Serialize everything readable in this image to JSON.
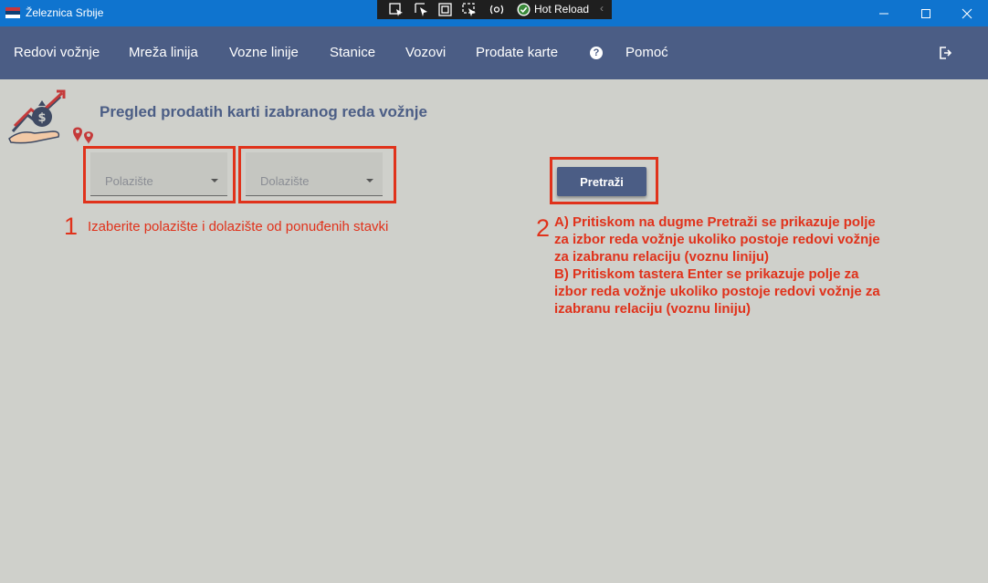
{
  "window": {
    "title": "Železnica Srbije",
    "hot_reload_label": "Hot Reload"
  },
  "nav": {
    "items": [
      "Redovi vožnje",
      "Mreža linija",
      "Vozne linije",
      "Stanice",
      "Vozovi",
      "Prodate karte"
    ],
    "help_label": "Pomoć",
    "help_icon": "?"
  },
  "main": {
    "title": "Pregled prodatih karti izabranog reda vožnje",
    "departure_placeholder": "Polazište",
    "arrival_placeholder": "Dolazište",
    "search_button": "Pretraži"
  },
  "annotations": {
    "step1_number": "1",
    "step1_text": "Izaberite polazište i dolazište od ponuđenih stavki",
    "step2_number": "2",
    "step2_lines": [
      "A) Pritiskom na dugme Pretraži se prikazuje polje",
      "za izbor reda vožnje ukoliko postoje redovi vožnje",
      "za izabranu relaciju (voznu liniju)",
      "B) Pritiskom tastera Enter se prikazuje polje za",
      "izbor reda vožnje ukoliko postoje redovi vožnje za",
      "izabranu relaciju (voznu liniju)"
    ]
  },
  "colors": {
    "titlebar": "#0f74cf",
    "nav": "#4b5d85",
    "background": "#cfd0cb",
    "annotation": "#e0321b"
  }
}
